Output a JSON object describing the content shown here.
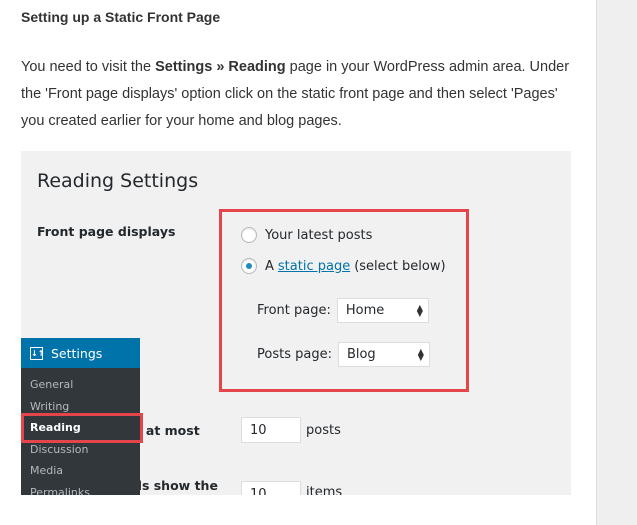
{
  "article": {
    "heading": "Setting up a Static Front Page",
    "para_prefix": "You need to visit the ",
    "para_bold": "Settings » Reading",
    "para_rest": " page in your WordPress admin area. Under the 'Front page displays' option click on the static front page and then select 'Pages' you created earlier for your home and blog pages."
  },
  "screenshot": {
    "title": "Reading Settings",
    "front_page_displays_label": "Front page displays",
    "options": {
      "latest_posts": "Your latest posts",
      "static_prefix": "A",
      "static_link": "static page",
      "static_suffix": "(select below)",
      "selected": "static page"
    },
    "front_page": {
      "label": "Front page:",
      "value": "Home"
    },
    "posts_page": {
      "label": "Posts page:",
      "value": "Blog"
    },
    "blog_pages_label_partial": "w at most",
    "blog_pages_value": "10",
    "blog_pages_unit": "posts",
    "syndication_label_partial": "ds show the",
    "syndication_value": "10",
    "syndication_unit": "items",
    "admin_menu": {
      "header": "Settings",
      "items": [
        "General",
        "Writing",
        "Reading",
        "Discussion",
        "Media",
        "Permalinks"
      ],
      "active": "Reading"
    }
  },
  "colors": {
    "highlight": "#e4454a",
    "wp_blue": "#0073aa",
    "admin_dark": "#32373c"
  }
}
